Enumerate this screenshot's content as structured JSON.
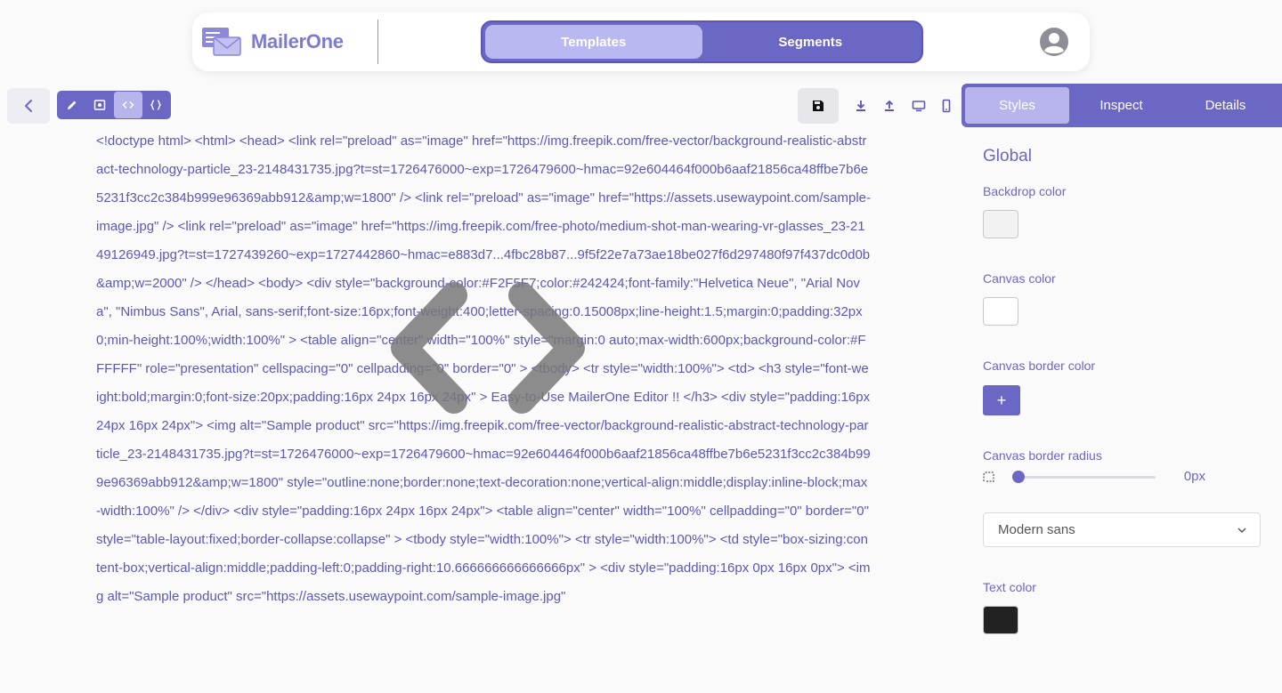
{
  "header": {
    "brand": "MailerOne",
    "tabs": [
      {
        "label": "Templates",
        "active": true
      },
      {
        "label": "Segments",
        "active": false
      }
    ]
  },
  "colors": {
    "accent": "#6b67c4",
    "accent_light": "#b7b5ec",
    "backdrop_color": "#f2f2f2",
    "canvas_color": "#ffffff",
    "text_color": "#222222"
  },
  "icons": {
    "back": "chevron-left-icon",
    "modes": [
      "pencil-icon",
      "preview-icon",
      "html-code-icon",
      "json-icon"
    ],
    "save": "floppy-disk-icon",
    "tools": [
      "download-icon",
      "upload-icon",
      "desktop-icon",
      "mobile-icon"
    ],
    "overlay": "code-brackets-icon",
    "avatar": "user-avatar-icon"
  },
  "editor": {
    "code": "<!doctype html> <html> <head> <link rel=\"preload\" as=\"image\" href=\"https://img.freepik.com/free-vector/background-realistic-abstract-technology-particle_23-2148431735.jpg?t=st=1726476000~exp=1726479600~hmac=92e604464f000b6aaf21856ca48ffbe7b6e5231f3cc2c384b999e96369abb912&amp;w=1800\" /> <link rel=\"preload\" as=\"image\" href=\"https://assets.usewaypoint.com/sample-image.jpg\" /> <link rel=\"preload\" as=\"image\" href=\"https://img.freepik.com/free-photo/medium-shot-man-wearing-vr-glasses_23-2149126949.jpg?t=st=1727439260~exp=1727442860~hmac=e883d7...4fbc28b87...9f5f22e7a73ae18be027f6d297480f97f437dc0d0b&amp;w=2000\" /> </head> <body> <div style=\"background-color:#F2F5F7;color:#242424;font-family:\"Helvetica Neue\", \"Arial Nova\", \"Nimbus Sans\", Arial, sans-serif;font-size:16px;font-weight:400;letter-spacing:0.15008px;line-height:1.5;margin:0;padding:32px 0;min-height:100%;width:100%\" > <table align=\"center\" width=\"100%\" style=\"margin:0 auto;max-width:600px;background-color:#FFFFFF\" role=\"presentation\" cellspacing=\"0\" cellpadding=\"0\" border=\"0\" > <tbody> <tr style=\"width:100%\"> <td> <h3 style=\"font-weight:bold;margin:0;font-size:20px;padding:16px 24px 16px 24px\" > Easy-to-Use MailerOne Editor !! </h3> <div style=\"padding:16px 24px 16px 24px\"> <img alt=\"Sample product\" src=\"https://img.freepik.com/free-vector/background-realistic-abstract-technology-particle_23-2148431735.jpg?t=st=1726476000~exp=1726479600~hmac=92e604464f000b6aaf21856ca48ffbe7b6e5231f3cc2c384b999e96369abb912&amp;w=1800\" style=\"outline:none;border:none;text-decoration:none;vertical-align:middle;display:inline-block;max-width:100%\" /> </div> <div style=\"padding:16px 24px 16px 24px\"> <table align=\"center\" width=\"100%\" cellpadding=\"0\" border=\"0\" style=\"table-layout:fixed;border-collapse:collapse\" > <tbody style=\"width:100%\"> <tr style=\"width:100%\"> <td style=\"box-sizing:content-box;vertical-align:middle;padding-left:0;padding-right:10.666666666666666px\" > <div style=\"padding:16px 0px 16px 0px\"> <img alt=\"Sample product\" src=\"https://assets.usewaypoint.com/sample-image.jpg\""
  },
  "panel": {
    "tabs": [
      {
        "label": "Styles",
        "active": true
      },
      {
        "label": "Inspect",
        "active": false
      },
      {
        "label": "Details",
        "active": false
      }
    ],
    "title": "Global",
    "backdrop_label": "Backdrop color",
    "canvas_label": "Canvas color",
    "canvas_border_label": "Canvas border color",
    "add_symbol": "+",
    "radius_label": "Canvas border radius",
    "radius_value": "0px",
    "radius_fraction": 0,
    "font_value": "Modern sans",
    "text_color_label": "Text color"
  }
}
